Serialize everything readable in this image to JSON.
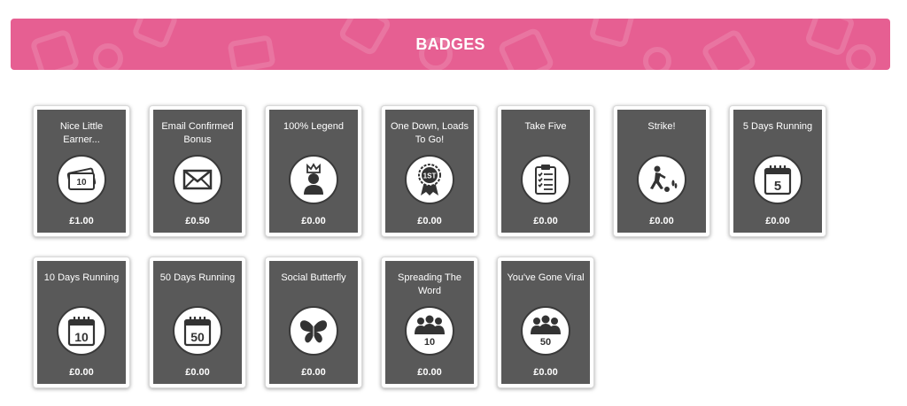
{
  "page": {
    "title": "BADGES"
  },
  "colors": {
    "banner": "#e65f92",
    "card": "#595959",
    "icon_bg": "#ffffff"
  },
  "badges": [
    {
      "title": "Nice Little Earner...",
      "value": "£1.00",
      "icon": "money-icon"
    },
    {
      "title": "Email Confirmed Bonus",
      "value": "£0.50",
      "icon": "envelope-icon"
    },
    {
      "title": "100% Legend",
      "value": "£0.00",
      "icon": "crowned-person-icon"
    },
    {
      "title": "One Down, Loads To Go!",
      "value": "£0.00",
      "icon": "rosette-1st-icon",
      "icon_text": "1ST"
    },
    {
      "title": "Take Five",
      "value": "£0.00",
      "icon": "clipboard-icon"
    },
    {
      "title": "Strike!",
      "value": "£0.00",
      "icon": "bowling-icon"
    },
    {
      "title": "5 Days Running",
      "value": "£0.00",
      "icon": "calendar-icon",
      "icon_text": "5"
    },
    {
      "title": "10 Days Running",
      "value": "£0.00",
      "icon": "calendar-icon",
      "icon_text": "10"
    },
    {
      "title": "50 Days Running",
      "value": "£0.00",
      "icon": "calendar-icon",
      "icon_text": "50"
    },
    {
      "title": "Social Butterfly",
      "value": "£0.00",
      "icon": "butterfly-icon"
    },
    {
      "title": "Spreading The Word",
      "value": "£0.00",
      "icon": "crowd-icon",
      "icon_text": "10"
    },
    {
      "title": "You've Gone Viral",
      "value": "£0.00",
      "icon": "crowd-icon",
      "icon_text": "50"
    }
  ]
}
